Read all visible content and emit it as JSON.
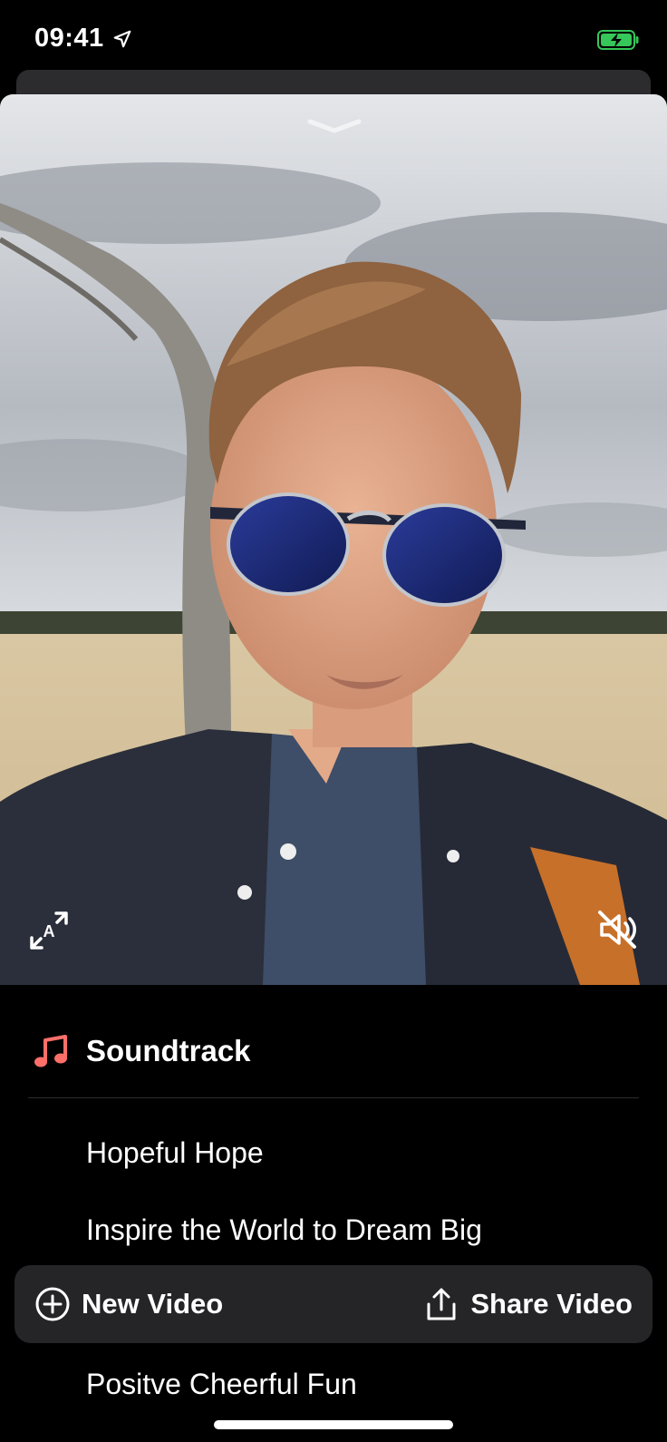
{
  "status_bar": {
    "time": "09:41",
    "location_icon": "location-arrow-icon",
    "battery_icon": "battery-charging-icon",
    "battery_color": "#35c759"
  },
  "video": {
    "grabber_icon": "chevron-down-icon",
    "ar_button_icon": "ar-scale-icon",
    "ar_button_letter": "A",
    "mute_button_icon": "speaker-off-icon"
  },
  "soundtrack": {
    "icon": "music-note-icon",
    "icon_color": "#ff6f6a",
    "title": "Soundtrack",
    "tracks": [
      "Hopeful Hope",
      "Inspire the World to Dream Big",
      "Positve Cheerful Fun"
    ]
  },
  "toolbar": {
    "new_video_icon": "plus-circle-icon",
    "new_video_label": "New Video",
    "share_video_icon": "share-icon",
    "share_video_label": "Share Video"
  }
}
